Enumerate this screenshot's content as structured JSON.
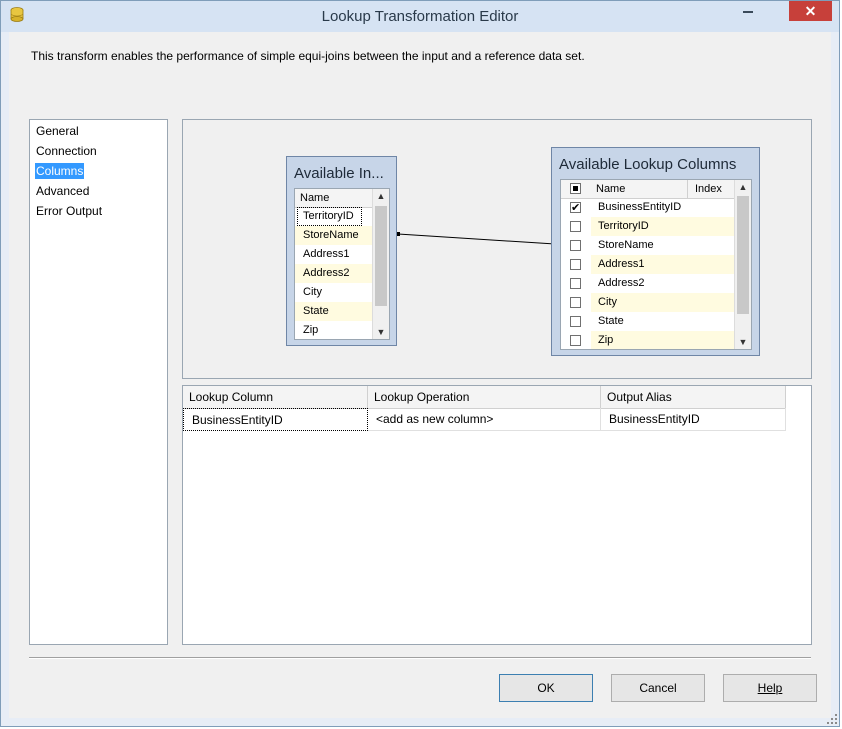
{
  "window": {
    "title": "Lookup Transformation Editor",
    "close_label": "✕",
    "icon": "database-icon"
  },
  "description": "This transform enables the performance of simple equi-joins between the input and a reference data set.",
  "nav": {
    "items": [
      {
        "label": "General",
        "selected": false
      },
      {
        "label": "Connection",
        "selected": false
      },
      {
        "label": "Columns",
        "selected": true
      },
      {
        "label": "Advanced",
        "selected": false
      },
      {
        "label": "Error Output",
        "selected": false
      }
    ]
  },
  "input_panel": {
    "title": "Available In...",
    "header_name": "Name",
    "rows": [
      {
        "name": "TerritoryID",
        "highlighted": false
      },
      {
        "name": "StoreName",
        "highlighted": true
      },
      {
        "name": "Address1",
        "highlighted": false
      },
      {
        "name": "Address2",
        "highlighted": true
      },
      {
        "name": "City",
        "highlighted": false
      },
      {
        "name": "State",
        "highlighted": true
      },
      {
        "name": "Zip",
        "highlighted": false
      }
    ]
  },
  "lookup_panel": {
    "title": "Available Lookup Columns",
    "header_name": "Name",
    "header_index": "Index",
    "rows": [
      {
        "name": "BusinessEntityID",
        "checked": true,
        "highlighted": false
      },
      {
        "name": "TerritoryID",
        "checked": false,
        "highlighted": true
      },
      {
        "name": "StoreName",
        "checked": false,
        "highlighted": false
      },
      {
        "name": "Address1",
        "checked": false,
        "highlighted": true
      },
      {
        "name": "Address2",
        "checked": false,
        "highlighted": false
      },
      {
        "name": "City",
        "checked": false,
        "highlighted": true
      },
      {
        "name": "State",
        "checked": false,
        "highlighted": false
      },
      {
        "name": "Zip",
        "checked": false,
        "highlighted": true
      }
    ]
  },
  "output_grid": {
    "headers": [
      "Lookup Column",
      "Lookup Operation",
      "Output Alias"
    ],
    "rows": [
      [
        "BusinessEntityID",
        "<add as new column>",
        "BusinessEntityID"
      ]
    ]
  },
  "buttons": {
    "ok": "OK",
    "cancel": "Cancel",
    "help": "Help"
  },
  "colors": {
    "selection": "#3399ff",
    "highlight_row": "#fffbe0",
    "panel": "#c7d5e8",
    "close_button": "#c7403a"
  }
}
